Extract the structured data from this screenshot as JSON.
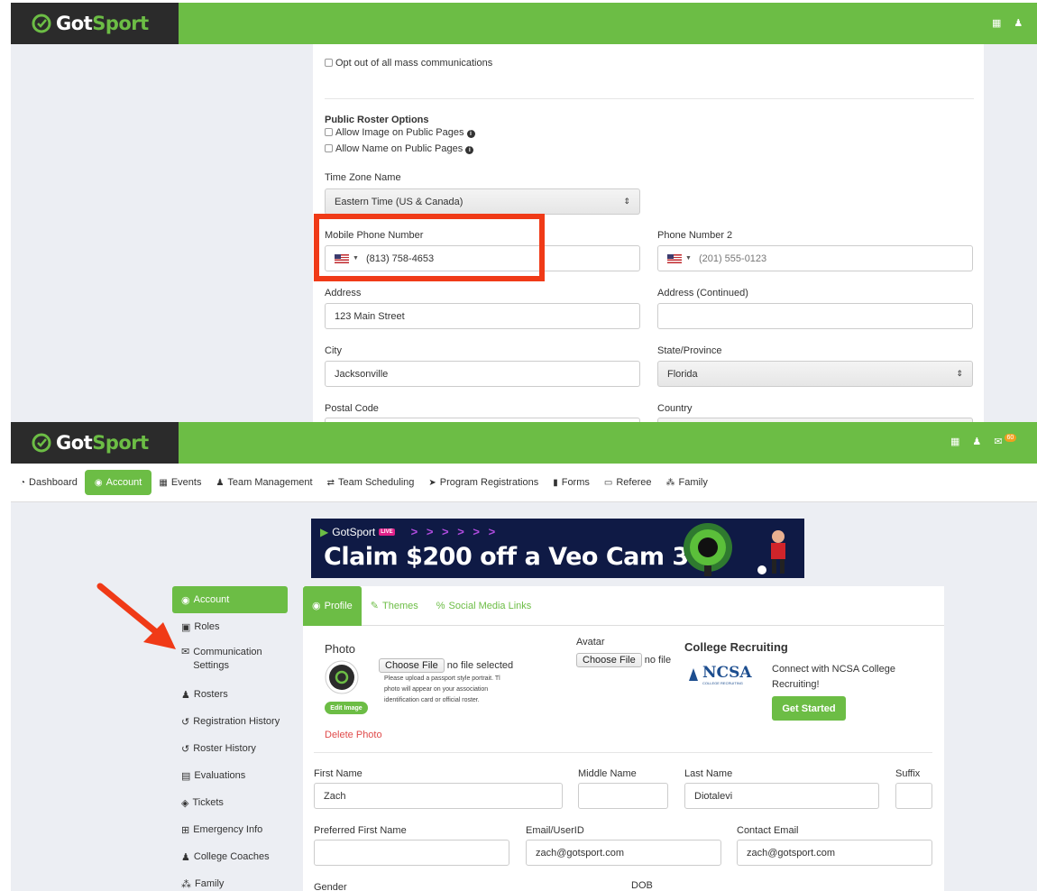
{
  "colors": {
    "brand_green": "#6cbd45",
    "header_dark": "#2b2b2b",
    "highlight_red": "#f03a17",
    "banner_navy": "#0f1a45"
  },
  "brand": {
    "logo_prefix": "Got",
    "logo_suffix": "Sport"
  },
  "top": {
    "opt_out_label": "Opt out of all mass communications",
    "public_roster_title": "Public Roster Options",
    "allow_image_label": "Allow Image on Public Pages",
    "allow_name_label": "Allow Name on Public Pages",
    "timezone_label": "Time Zone Name",
    "timezone_value": "Eastern Time (US & Canada)",
    "mobile_label": "Mobile Phone Number",
    "mobile_value": "(813) 758-4653",
    "phone2_label": "Phone Number 2",
    "phone2_placeholder": "(201) 555-0123",
    "address_label": "Address",
    "address_value": "123 Main Street",
    "address2_label": "Address (Continued)",
    "city_label": "City",
    "city_value": "Jacksonville",
    "state_label": "State/Province",
    "state_value": "Florida",
    "postal_label": "Postal Code",
    "country_label": "Country"
  },
  "header_icons": [
    "qr-icon",
    "user-icon",
    "mail-icon"
  ],
  "notification_count": "60",
  "nav": {
    "items": [
      {
        "label": "Dashboard",
        "icon": "dashboard-icon"
      },
      {
        "label": "Account",
        "icon": "account-icon",
        "active": true
      },
      {
        "label": "Events",
        "icon": "calendar-icon"
      },
      {
        "label": "Team Management",
        "icon": "team-icon"
      },
      {
        "label": "Team Scheduling",
        "icon": "swap-icon"
      },
      {
        "label": "Program Registrations",
        "icon": "send-icon"
      },
      {
        "label": "Forms",
        "icon": "forms-icon"
      },
      {
        "label": "Referee",
        "icon": "calendar-icon"
      },
      {
        "label": "Family",
        "icon": "family-icon"
      }
    ]
  },
  "banner": {
    "brand": "GotSport",
    "live": "LIVE",
    "arrows": "> > > > > >",
    "headline": "Claim $200 off a Veo Cam 3"
  },
  "side_menu": {
    "items": [
      {
        "label": "Account",
        "icon": "account-icon",
        "active": true
      },
      {
        "label": "Roles",
        "icon": "id-card-icon"
      },
      {
        "label": "Communication Settings",
        "icon": "envelope-icon"
      },
      {
        "label": "Rosters",
        "icon": "team-icon"
      },
      {
        "label": "Registration History",
        "icon": "history-icon"
      },
      {
        "label": "Roster History",
        "icon": "history-icon"
      },
      {
        "label": "Evaluations",
        "icon": "evaluation-icon"
      },
      {
        "label": "Tickets",
        "icon": "ticket-icon"
      },
      {
        "label": "Emergency Info",
        "icon": "plus-square-icon"
      },
      {
        "label": "College Coaches",
        "icon": "user-icon"
      },
      {
        "label": "Family",
        "icon": "family-icon"
      }
    ]
  },
  "tabs": [
    {
      "label": "Profile",
      "active": true
    },
    {
      "label": "Themes"
    },
    {
      "label": "Social Media Links"
    }
  ],
  "profile": {
    "photo_label": "Photo",
    "choose_file": "Choose File",
    "no_file": "no file selected",
    "photo_help": [
      "Please upload a passport style portrait. Tl",
      "photo will appear on your association",
      "identification card or official roster."
    ],
    "edit_image": "Edit Image",
    "delete_photo": "Delete Photo",
    "avatar_label": "Avatar",
    "avatar_no_file": "no file",
    "college_title": "College Recruiting",
    "ncsa": "NCSA",
    "ncsa_sub": "COLLEGE RECRUITING",
    "college_text_1": "Connect with NCSA College",
    "college_text_2": "Recruiting!",
    "get_started": "Get Started",
    "first_name_label": "First Name",
    "first_name": "Zach",
    "middle_name_label": "Middle Name",
    "last_name_label": "Last Name",
    "last_name": "Diotalevi",
    "suffix_label": "Suffix",
    "preferred_label": "Preferred First Name",
    "email_label": "Email/UserID",
    "email": "zach@gotsport.com",
    "contact_email_label": "Contact Email",
    "contact_email": "zach@gotsport.com",
    "gender_label": "Gender",
    "dob_label": "DOB"
  }
}
